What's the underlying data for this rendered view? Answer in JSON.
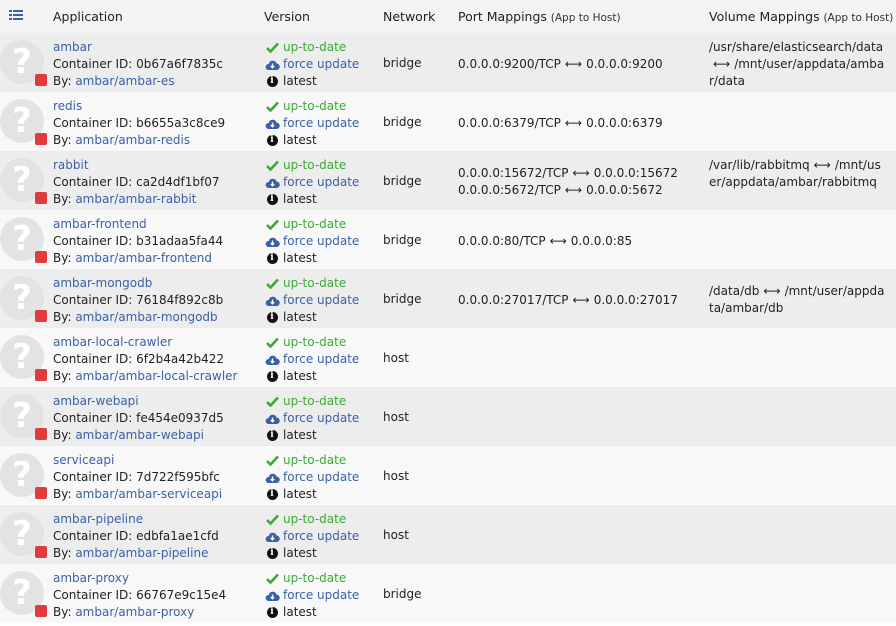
{
  "header": {
    "toggle_icon": "list-view-icon",
    "application": "Application",
    "version": "Version",
    "network": "Network",
    "port": "Port Mappings",
    "port_sub": "(App to Host)",
    "volume": "Volume Mappings",
    "volume_sub": "(App to Host)"
  },
  "colors": {
    "status": "#e23b3b",
    "link": "#3a61a8",
    "ok": "#3aaa35"
  },
  "labels": {
    "container_prefix": "Container ID: ",
    "by_prefix": "By: ",
    "up_to_date": "up-to-date",
    "force_update": "force update",
    "latest": "latest",
    "arrow": "⟷"
  },
  "rows": [
    {
      "name": "ambar",
      "id": "0b67a6f7835c",
      "repo": "ambar/ambar-es",
      "network": "bridge",
      "ports": [
        [
          "0.0.0.0:9200/TCP",
          "0.0.0.0:9200"
        ]
      ],
      "volumes": [
        [
          "/usr/share/elasticsearch/data",
          "/mnt/user/appdata/ambar/data"
        ]
      ]
    },
    {
      "name": "redis",
      "id": "b6655a3c8ce9",
      "repo": "ambar/ambar-redis",
      "network": "bridge",
      "ports": [
        [
          "0.0.0.0:6379/TCP",
          "0.0.0.0:6379"
        ]
      ],
      "volumes": []
    },
    {
      "name": "rabbit",
      "id": "ca2d4df1bf07",
      "repo": "ambar/ambar-rabbit",
      "network": "bridge",
      "ports": [
        [
          "0.0.0.0:15672/TCP",
          "0.0.0.0:15672"
        ],
        [
          "0.0.0.0:5672/TCP",
          "0.0.0.0:5672"
        ]
      ],
      "volumes": [
        [
          "/var/lib/rabbitmq",
          "/mnt/user/appdata/ambar/rabbitmq"
        ]
      ]
    },
    {
      "name": "ambar-frontend",
      "id": "b31adaa5fa44",
      "repo": "ambar/ambar-frontend",
      "network": "bridge",
      "ports": [
        [
          "0.0.0.0:80/TCP",
          "0.0.0.0:85"
        ]
      ],
      "volumes": []
    },
    {
      "name": "ambar-mongodb",
      "id": "76184f892c8b",
      "repo": "ambar/ambar-mongodb",
      "network": "bridge",
      "ports": [
        [
          "0.0.0.0:27017/TCP",
          "0.0.0.0:27017"
        ]
      ],
      "volumes": [
        [
          "/data/db",
          "/mnt/user/appdata/ambar/db"
        ]
      ]
    },
    {
      "name": "ambar-local-crawler",
      "id": "6f2b4a42b422",
      "repo": "ambar/ambar-local-crawler",
      "network": "host",
      "ports": [],
      "volumes": []
    },
    {
      "name": "ambar-webapi",
      "id": "fe454e0937d5",
      "repo": "ambar/ambar-webapi",
      "network": "host",
      "ports": [],
      "volumes": []
    },
    {
      "name": "serviceapi",
      "id": "7d722f595bfc",
      "repo": "ambar/ambar-serviceapi",
      "network": "host",
      "ports": [],
      "volumes": []
    },
    {
      "name": "ambar-pipeline",
      "id": "edbfa1ae1cfd",
      "repo": "ambar/ambar-pipeline",
      "network": "host",
      "ports": [],
      "volumes": []
    },
    {
      "name": "ambar-proxy",
      "id": "66767e9c15e4",
      "repo": "ambar/ambar-proxy",
      "network": "bridge",
      "ports": [],
      "volumes": []
    }
  ]
}
